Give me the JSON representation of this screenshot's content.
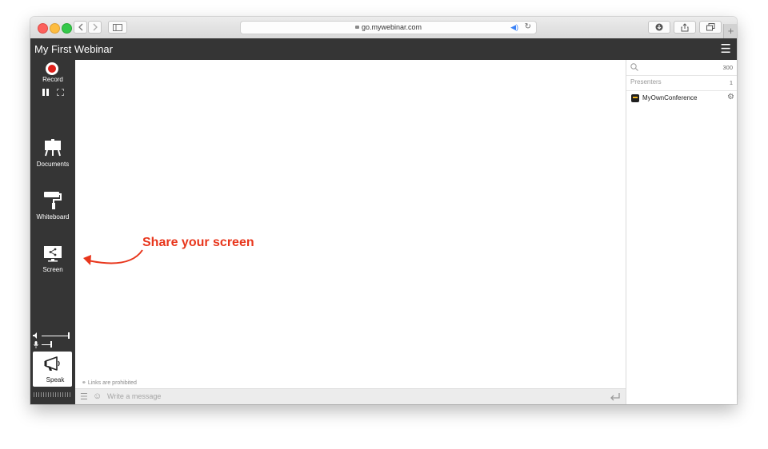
{
  "browser": {
    "url": "go.mywebinar.com",
    "new_tab_label": "+"
  },
  "header": {
    "title": "My First Webinar",
    "menu_icon": "☰"
  },
  "rail": {
    "record_label": "Record",
    "documents_label": "Documents",
    "whiteboard_label": "Whiteboard",
    "screen_label": "Screen",
    "speak_label": "Speak"
  },
  "stage": {
    "annotation": "Share your screen",
    "links_note": "Links are prohibited",
    "chat_placeholder": "Write a message"
  },
  "panel": {
    "search_count": "300",
    "presenters_label": "Presenters",
    "presenters_count": "1",
    "members": [
      {
        "name": "MyOwnConference"
      }
    ]
  },
  "colors": {
    "dark": "#353535",
    "record": "#e0201b",
    "annotation": "#e8361c",
    "logo_accent": "#f3b61f"
  }
}
